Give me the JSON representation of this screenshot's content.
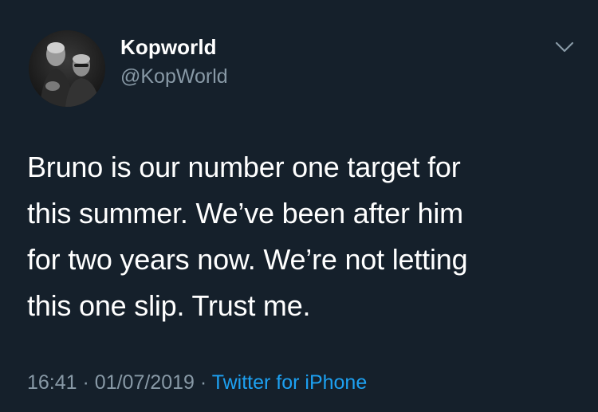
{
  "user": {
    "display_name": "Kopworld",
    "handle": "@KopWorld"
  },
  "menu": {
    "icon": "chevron-down-icon"
  },
  "tweet": {
    "text": "Bruno is our number one target for\nthis summer. We’ve been after him\nfor two years now. We’re not letting\nthis one slip. Trust me."
  },
  "meta": {
    "time": "16:41",
    "separator": "·",
    "date": "01/07/2019",
    "source": "Twitter for iPhone"
  },
  "colors": {
    "background": "#15202b",
    "primary_text": "#ffffff",
    "secondary_text": "#8899a6",
    "link": "#1da1f2"
  }
}
